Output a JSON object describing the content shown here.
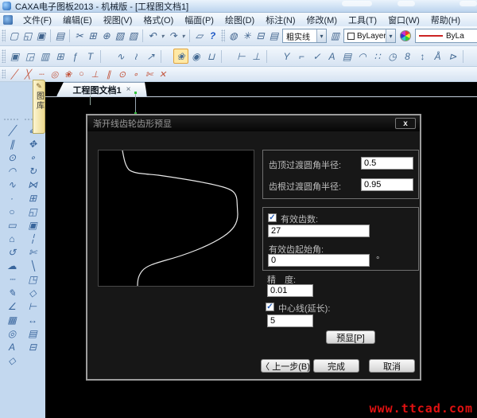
{
  "window": {
    "title": "CAXA电子图板2013 - 机械版 - [工程图文档1]"
  },
  "menu": {
    "items": [
      "文件(F)",
      "编辑(E)",
      "视图(V)",
      "格式(O)",
      "幅面(P)",
      "绘图(D)",
      "标注(N)",
      "修改(M)",
      "工具(T)",
      "窗口(W)",
      "帮助(H)"
    ]
  },
  "toolbars": {
    "row1": [
      {
        "name": "new-file-icon",
        "g": "▢"
      },
      {
        "name": "open-file-icon",
        "g": "◱"
      },
      {
        "name": "save-file-icon",
        "g": "▣"
      },
      {
        "name": "toolbar-separator",
        "cls": "tsep",
        "int": "false",
        "g": ""
      },
      {
        "name": "print-icon",
        "g": "▤"
      },
      {
        "name": "toolbar-separator",
        "cls": "tsep",
        "int": "false",
        "g": ""
      },
      {
        "name": "cut-icon",
        "g": "✂"
      },
      {
        "name": "copy-icon",
        "g": "⊞"
      },
      {
        "name": "copy-basepoint-icon",
        "g": "⊕"
      },
      {
        "name": "paste-icon",
        "g": "▧"
      },
      {
        "name": "paste-special-icon",
        "g": "▨"
      },
      {
        "name": "toolbar-separator",
        "cls": "tsep",
        "int": "false",
        "g": ""
      },
      {
        "name": "undo-icon",
        "g": "↶"
      },
      {
        "name": "undo-dropdown-icon",
        "cls": "dd",
        "g": "▾"
      },
      {
        "name": "redo-icon",
        "g": "↷"
      },
      {
        "name": "redo-dropdown-icon",
        "cls": "dd",
        "g": "▾"
      },
      {
        "name": "toolbar-separator",
        "cls": "tsep",
        "int": "false",
        "g": ""
      },
      {
        "name": "ole-object-icon",
        "g": "▱"
      },
      {
        "name": "help-icon",
        "cls": "c-help",
        "g": "?"
      }
    ],
    "layer_icons": [
      {
        "name": "layer-on-icon",
        "g": "◍"
      },
      {
        "name": "layer-bright-icon",
        "g": "✳"
      },
      {
        "name": "layer-lock-icon",
        "g": "⊟"
      },
      {
        "name": "layer-print-icon",
        "g": "▤"
      }
    ],
    "linestyle_combo": "粗实线",
    "layer_manager_icon": "▥",
    "color_combo": "ByLayer",
    "linetype_combo": "ByLa",
    "combo_arrow": "▾",
    "row2": [
      {
        "name": "drawing-frame-icon",
        "g": "▣"
      },
      {
        "name": "frame-settings-icon",
        "g": "◲"
      },
      {
        "name": "title-block-icon",
        "g": "▥"
      },
      {
        "name": "parameter-table-icon",
        "g": "⊞"
      },
      {
        "name": "part-number-icon",
        "g": "ƒ"
      },
      {
        "name": "bom-table-icon",
        "g": "T"
      },
      {
        "name": "toolbar-separator",
        "cls": "tsep",
        "int": "false",
        "g": ""
      },
      {
        "name": "wave-line-icon",
        "g": "∿"
      },
      {
        "name": "break-line-icon",
        "g": "≀"
      },
      {
        "name": "arrow-icon",
        "g": "↗"
      },
      {
        "name": "toolbar-separator",
        "cls": "tsep",
        "int": "false",
        "g": ""
      },
      {
        "name": "gear-tool-icon",
        "cls": "hl",
        "g": "❀"
      },
      {
        "name": "symbol-library-icon",
        "g": "◉"
      },
      {
        "name": "construction-icon",
        "g": "⊔"
      },
      {
        "name": "toolbar-separator",
        "cls": "tsep",
        "int": "false",
        "g": ""
      },
      {
        "name": "linear-dimension-icon",
        "g": "⊢"
      },
      {
        "name": "coordinate-dimension-icon",
        "g": "⊥"
      },
      {
        "name": "toolbar-separator",
        "cls": "tsep",
        "int": "false",
        "g": ""
      },
      {
        "name": "split-icon",
        "g": "Y"
      },
      {
        "name": "leader-icon",
        "g": "⌐"
      },
      {
        "name": "check-icon",
        "g": "✓"
      },
      {
        "name": "datum-icon",
        "g": "A"
      },
      {
        "name": "image-icon",
        "g": "▤"
      },
      {
        "name": "arc-dimension-icon",
        "g": "◠"
      },
      {
        "name": "pattern-icon",
        "g": "∷"
      },
      {
        "name": "angle-dimension-icon",
        "g": "◷"
      },
      {
        "name": "text-size-icon",
        "g": "8"
      },
      {
        "name": "updown-icon",
        "g": "↕"
      },
      {
        "name": "abc-icon",
        "g": "Å"
      },
      {
        "name": "flag-icon",
        "g": "⊳"
      },
      {
        "name": "toolbar-separator",
        "cls": "tsep",
        "int": "false",
        "g": ""
      },
      {
        "name": "properties-icon",
        "g": "▤"
      },
      {
        "name": "ruler-icon",
        "g": "≡"
      },
      {
        "name": "toolbar-separator",
        "cls": "tsep",
        "int": "false",
        "g": ""
      },
      {
        "name": "refresh-icon",
        "g": "↻"
      }
    ],
    "row3": [
      {
        "name": "snap-line-icon",
        "g": "╱"
      },
      {
        "name": "snap-intersection-icon",
        "g": "╳"
      },
      {
        "name": "snap-dash-icon",
        "g": "┄"
      },
      {
        "name": "snap-center-icon",
        "g": "◎"
      },
      {
        "name": "snap-quadrant-icon",
        "g": "❀"
      },
      {
        "name": "snap-circle-icon",
        "g": "○"
      },
      {
        "name": "snap-perpendicular-icon",
        "g": "⊥"
      },
      {
        "name": "snap-parallel-icon",
        "g": "∥"
      },
      {
        "name": "snap-tangent-icon",
        "g": "⊙"
      },
      {
        "name": "snap-point-icon",
        "g": "∘"
      },
      {
        "name": "snap-trim-icon",
        "g": "✄"
      },
      {
        "name": "snap-off-icon",
        "g": "✕"
      }
    ]
  },
  "sidebar": {
    "col1": [
      {
        "name": "line-tool-icon",
        "g": "╱"
      },
      {
        "name": "parallel-line-tool-icon",
        "g": "∥"
      },
      {
        "name": "circle-tool-icon",
        "g": "⊙"
      },
      {
        "name": "arc-tool-icon",
        "g": "◠"
      },
      {
        "name": "spline-tool-icon",
        "g": "∿"
      },
      {
        "name": "point-tool-icon",
        "g": "·"
      },
      {
        "name": "ellipse-tool-icon",
        "g": "○"
      },
      {
        "name": "rectangle-tool-icon",
        "g": "▭"
      },
      {
        "name": "polygon-tool-icon",
        "g": "⌂"
      },
      {
        "name": "revision-curve-icon",
        "g": "↺"
      },
      {
        "name": "cloud-tool-icon",
        "g": "☁"
      },
      {
        "name": "centerline-tool-icon",
        "g": "┄"
      },
      {
        "name": "sketch-tool-icon",
        "g": "✎"
      },
      {
        "name": "chamfer-tool-icon",
        "g": "∠"
      },
      {
        "name": "hatch-tool-icon",
        "g": "▦"
      },
      {
        "name": "region-tool-icon",
        "g": "◎"
      },
      {
        "name": "text-tool-icon",
        "g": "A"
      },
      {
        "name": "drag-tool-icon",
        "g": "◇"
      }
    ],
    "col2": [
      {
        "name": "eraser-tool-icon",
        "g": "✐"
      },
      {
        "name": "move-tool-icon",
        "g": "✥"
      },
      {
        "name": "copy-tool-icon",
        "g": "∘"
      },
      {
        "name": "rotate-tool-icon",
        "g": "↻"
      },
      {
        "name": "mirror-tool-icon",
        "g": "⋈"
      },
      {
        "name": "array-tool-icon",
        "g": "⊞"
      },
      {
        "name": "scale-tool-icon",
        "g": "◱"
      },
      {
        "name": "offset-tool-icon",
        "g": "▣"
      },
      {
        "name": "break-tool-icon",
        "g": "╎"
      },
      {
        "name": "trim-tool-icon",
        "g": "✄"
      },
      {
        "name": "extend-tool-icon",
        "g": "╲"
      },
      {
        "name": "corner-tool-icon",
        "g": "◳"
      },
      {
        "name": "explode-tool-icon",
        "g": "◇"
      },
      {
        "name": "dimension-tool-icon",
        "g": "⊢"
      },
      {
        "name": "dim-arrow-tool-icon",
        "g": "↔"
      },
      {
        "name": "style-tool-icon",
        "g": "▤"
      },
      {
        "name": "props-tool-icon",
        "g": "⊟"
      }
    ]
  },
  "doc_tab": {
    "label": "工程图文档1",
    "close": "×"
  },
  "panel_tab": {
    "label": "图库"
  },
  "dialog": {
    "title": "渐开线齿轮齿形预显",
    "close": "x",
    "fields": {
      "tip_fillet_label": "齿顶过渡圆角半径:",
      "tip_fillet_value": "0.5",
      "root_fillet_label": "齿根过渡圆角半径:",
      "root_fillet_value": "0.95",
      "teeth_label": "有效齿数:",
      "teeth_value": "27",
      "start_angle_label": "有效齿起始角:",
      "start_angle_value": "0",
      "degree_symbol": "°",
      "precision_label": "精　度:",
      "precision_value": "0.01",
      "centerline_label": "中心线(延长):",
      "centerline_value": "5",
      "check_glyph": "✓"
    },
    "buttons": {
      "preview": "预显[P]",
      "back": "〈 上一步(B)",
      "finish": "完成",
      "cancel": "取消"
    }
  },
  "watermark": "www.ttcad.com",
  "colors": {
    "accent_red_line": "#cc2424",
    "watermark_red": "#e01111",
    "canvas_black": "#000000",
    "highlight_yellow": "#ffe9a6"
  }
}
